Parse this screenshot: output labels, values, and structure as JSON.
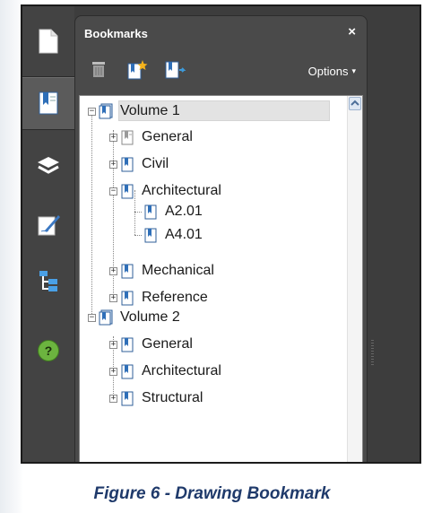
{
  "panel": {
    "title": "Bookmarks",
    "close_label": "×",
    "options_label": "Options",
    "options_caret": "▾"
  },
  "nav": {
    "items": [
      "pages-icon",
      "bookmarks-icon",
      "layers-icon",
      "signature-icon",
      "model-tree-icon",
      "help-icon"
    ],
    "active": "bookmarks-icon",
    "help_glyph": "?"
  },
  "toolbar": {
    "buttons": [
      "delete-bookmark-icon",
      "new-bookmark-icon",
      "move-bookmark-icon"
    ]
  },
  "tree": {
    "volume1": {
      "label": "Volume 1",
      "expander": "−",
      "children": {
        "general": {
          "label": "General",
          "expander": "+"
        },
        "civil": {
          "label": "Civil",
          "expander": "+"
        },
        "architectural": {
          "label": "Architectural",
          "expander": "−",
          "children": {
            "a201": {
              "label": "A2.01"
            },
            "a401": {
              "label": "A4.01"
            }
          }
        },
        "mechanical": {
          "label": "Mechanical",
          "expander": "+"
        },
        "reference": {
          "label": "Reference",
          "expander": "+"
        }
      }
    },
    "volume2": {
      "label": "Volume 2",
      "expander": "−",
      "children": {
        "general": {
          "label": "General",
          "expander": "+"
        },
        "architectural": {
          "label": "Architectural",
          "expander": "+"
        },
        "structural": {
          "label": "Structural",
          "expander": "+"
        }
      }
    }
  },
  "caption": "Figure 6 - Drawing Bookmark",
  "colors": {
    "panel_bg": "#4a4a4a",
    "nav_bg": "#434343",
    "caption": "#1f3a6b",
    "bookmark_blue": "#2f6fb8",
    "help_green": "#6cb43f"
  }
}
